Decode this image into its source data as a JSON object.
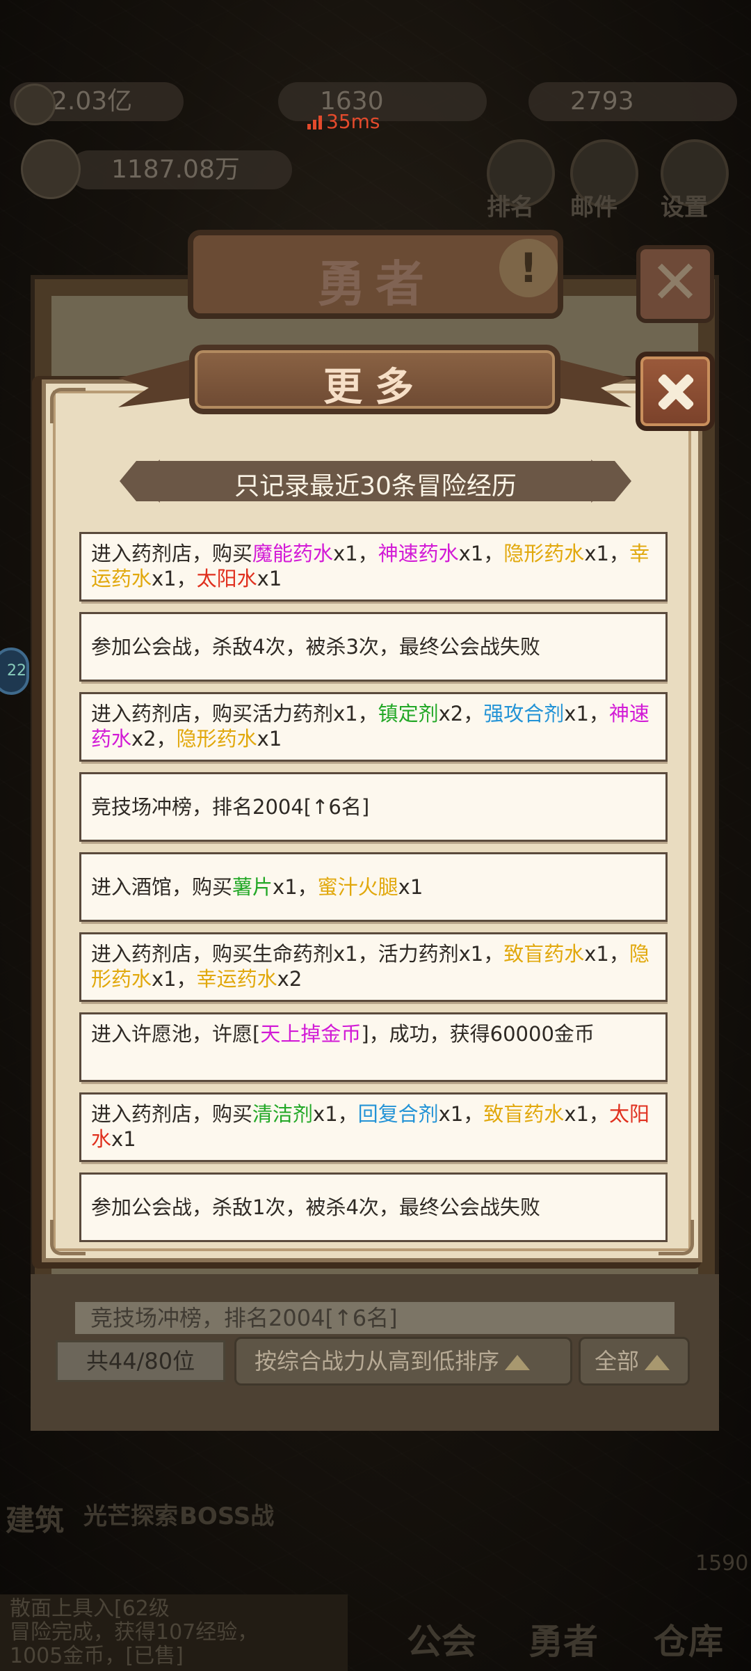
{
  "hud": {
    "gold": "2.03亿",
    "mid_value": "1630",
    "gems": "2793",
    "power": "1187.08万",
    "ping": "35ms",
    "top_buttons": [
      "排名",
      "邮件",
      "设置"
    ]
  },
  "back_panel": {
    "title": "勇者",
    "excl": "!",
    "row_text": "竞技场冲榜，排名2004[↑6名]",
    "count_label": "共44/80位",
    "sort_label": "按综合战力从高到低排序",
    "all_label": "全部"
  },
  "bottom_nav": [
    "建筑",
    "光芒探索",
    "BOSS战",
    "公会",
    "勇者",
    "仓库"
  ],
  "bottom_log": {
    "line1": "散面上具入[62级",
    "line2": "冒险完成，获得107经验，",
    "line3": "1005金币，",
    "badge": "[已售]",
    "count": "1590"
  },
  "modal": {
    "title": "更多",
    "subtitle": "只记录最近30条冒险经历",
    "entries": [
      [
        {
          "t": "进入药剂店，购买"
        },
        {
          "t": "魔能药水",
          "c": "mag"
        },
        {
          "t": "x1，"
        },
        {
          "t": "神速药水",
          "c": "mag"
        },
        {
          "t": "x1，"
        },
        {
          "t": "隐形药水",
          "c": "gold"
        },
        {
          "t": "x1，"
        },
        {
          "t": "幸运药水",
          "c": "gold"
        },
        {
          "t": "x1，"
        },
        {
          "t": "太阳水",
          "c": "red"
        },
        {
          "t": "x1"
        }
      ],
      [
        {
          "t": "参加公会战，杀敌4次，被杀3次，最终公会战失败"
        }
      ],
      [
        {
          "t": "进入药剂店，购买活力药剂x1，"
        },
        {
          "t": "镇定剂",
          "c": "green"
        },
        {
          "t": "x2，"
        },
        {
          "t": "强攻合剂",
          "c": "blue"
        },
        {
          "t": "x1，"
        },
        {
          "t": "神速药水",
          "c": "mag"
        },
        {
          "t": "x2，"
        },
        {
          "t": "隐形药水",
          "c": "gold"
        },
        {
          "t": "x1"
        }
      ],
      [
        {
          "t": "竞技场冲榜，排名2004[↑6名]"
        }
      ],
      [
        {
          "t": "进入酒馆，购买"
        },
        {
          "t": "薯片",
          "c": "green"
        },
        {
          "t": "x1，"
        },
        {
          "t": "蜜汁火腿",
          "c": "gold"
        },
        {
          "t": "x1"
        }
      ],
      [
        {
          "t": "进入药剂店，购买生命药剂x1，活力药剂x1，"
        },
        {
          "t": "致盲药水",
          "c": "gold"
        },
        {
          "t": "x1，"
        },
        {
          "t": "隐形药水",
          "c": "gold"
        },
        {
          "t": "x1，"
        },
        {
          "t": "幸运药水",
          "c": "gold"
        },
        {
          "t": "x2"
        }
      ],
      [
        {
          "t": "进入许愿池，许愿["
        },
        {
          "t": "天上掉金币",
          "c": "mag"
        },
        {
          "t": "]，成功，获得60000金币"
        }
      ],
      [
        {
          "t": "进入药剂店，购买"
        },
        {
          "t": "清洁剂",
          "c": "green"
        },
        {
          "t": "x1，"
        },
        {
          "t": "回复合剂",
          "c": "blue"
        },
        {
          "t": "x1，"
        },
        {
          "t": "致盲药水",
          "c": "gold"
        },
        {
          "t": "x1，"
        },
        {
          "t": "太阳水",
          "c": "red"
        },
        {
          "t": "x1"
        }
      ],
      [
        {
          "t": "参加公会战，杀敌1次，被杀4次，最终公会战失败"
        }
      ]
    ]
  },
  "colors": {
    "mag": "#d21ad6",
    "gold": "#e1a80c",
    "red": "#e0301e",
    "green": "#23a827",
    "blue": "#2393d6"
  }
}
